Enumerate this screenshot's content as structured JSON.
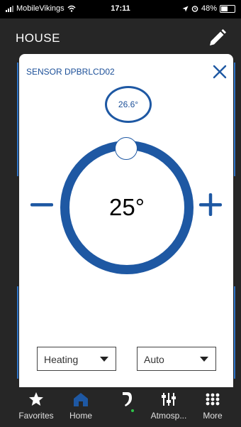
{
  "status_bar": {
    "carrier": "MobileVikings",
    "time": "17:11",
    "battery": "48%",
    "icons": [
      "signal-icon",
      "wifi-icon",
      "location-icon",
      "alarm-icon",
      "battery-icon"
    ]
  },
  "header": {
    "title": "HOUSE",
    "edit_icon": "pencil-icon"
  },
  "modal": {
    "sensor_title": "SENSOR DPBRLCD02",
    "current_temp": "26.6°",
    "setpoint": "25°",
    "mode_select": {
      "value": "Heating"
    },
    "fan_select": {
      "value": "Auto"
    }
  },
  "tab_bar": {
    "items": [
      {
        "label": "Favorites",
        "icon": "star-icon"
      },
      {
        "label": "Home",
        "icon": "home-icon"
      },
      {
        "label": "",
        "icon": "brand-logo-icon"
      },
      {
        "label": "Atmosp...",
        "icon": "sliders-icon"
      },
      {
        "label": "More",
        "icon": "grid-dots-icon"
      }
    ]
  },
  "colors": {
    "accent": "#1e58a3",
    "background": "#262626",
    "modal": "#ffffff"
  }
}
